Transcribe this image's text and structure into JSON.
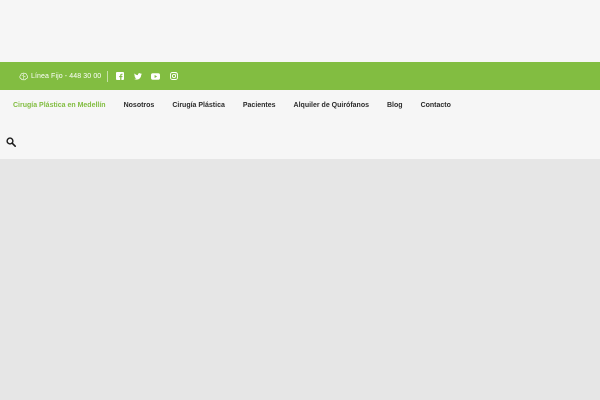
{
  "topbar": {
    "phone_text": "Línea Fijo - 448 30 00",
    "background": "#82bd41"
  },
  "social": [
    {
      "icon": "facebook-icon"
    },
    {
      "icon": "twitter-icon"
    },
    {
      "icon": "youtube-icon"
    },
    {
      "icon": "instagram-icon"
    }
  ],
  "nav": {
    "items": [
      {
        "label": "Cirugía Plástica en Medellín",
        "active": true
      },
      {
        "label": "Nosotros"
      },
      {
        "label": "Cirugía Plástica"
      },
      {
        "label": "Pacientes"
      },
      {
        "label": "Alquiler de Quirófanos"
      },
      {
        "label": "Blog"
      },
      {
        "label": "Contacto"
      }
    ],
    "active_color": "#82bd41"
  },
  "search": {
    "icon": "search-icon"
  }
}
